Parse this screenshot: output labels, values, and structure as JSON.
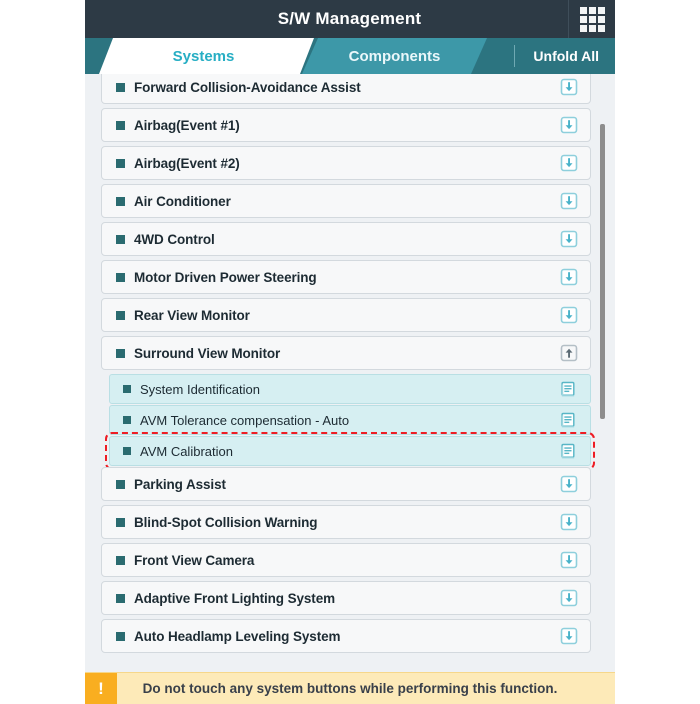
{
  "titlebar": {
    "title": "S/W Management",
    "grid_icon": "grid-menu-icon"
  },
  "tabs": {
    "systems": "Systems",
    "components": "Components",
    "unfold_all": "Unfold All"
  },
  "colors": {
    "titlebar_bg": "#2d3a45",
    "tabbar_bg": "#2c7480",
    "active_tab_bg": "#ffffff",
    "active_tab_text": "#27aec4",
    "inactive_tab_bg": "#3d98a8",
    "bullet": "#2a6b70",
    "subrow_bg": "#d6eff2",
    "selection_outline": "#ee1c24",
    "warn_icon_bg": "#f9ae20",
    "warn_bg": "#fdeab8"
  },
  "list": [
    {
      "label": "",
      "type": "system",
      "icon": "download-icon",
      "partial": true
    },
    {
      "label": "Forward Collision-Avoidance Assist",
      "type": "system",
      "icon": "download-icon"
    },
    {
      "label": "Airbag(Event #1)",
      "type": "system",
      "icon": "download-icon"
    },
    {
      "label": "Airbag(Event #2)",
      "type": "system",
      "icon": "download-icon"
    },
    {
      "label": "Air Conditioner",
      "type": "system",
      "icon": "download-icon"
    },
    {
      "label": "4WD Control",
      "type": "system",
      "icon": "download-icon"
    },
    {
      "label": "Motor Driven Power Steering",
      "type": "system",
      "icon": "download-icon"
    },
    {
      "label": "Rear View Monitor",
      "type": "system",
      "icon": "download-icon"
    },
    {
      "label": "Surround View Monitor",
      "type": "system",
      "icon": "upload-icon",
      "expanded": true
    },
    {
      "label": "System Identification",
      "type": "sub",
      "icon": "document-icon"
    },
    {
      "label": "AVM Tolerance compensation - Auto",
      "type": "sub",
      "icon": "document-icon"
    },
    {
      "label": "AVM Calibration",
      "type": "sub",
      "icon": "document-icon",
      "selected": true
    },
    {
      "label": "Parking Assist",
      "type": "system",
      "icon": "download-icon"
    },
    {
      "label": "Blind-Spot Collision Warning",
      "type": "system",
      "icon": "download-icon"
    },
    {
      "label": "Front View Camera",
      "type": "system",
      "icon": "download-icon"
    },
    {
      "label": "Adaptive Front Lighting System",
      "type": "system",
      "icon": "download-icon"
    },
    {
      "label": "Auto Headlamp Leveling System",
      "type": "system",
      "icon": "download-icon"
    }
  ],
  "scrollbar": {
    "name": "vertical-scrollbar"
  },
  "warning": {
    "icon": "exclamation-icon",
    "icon_glyph": "!",
    "message": "Do not touch any system buttons while performing this function."
  }
}
